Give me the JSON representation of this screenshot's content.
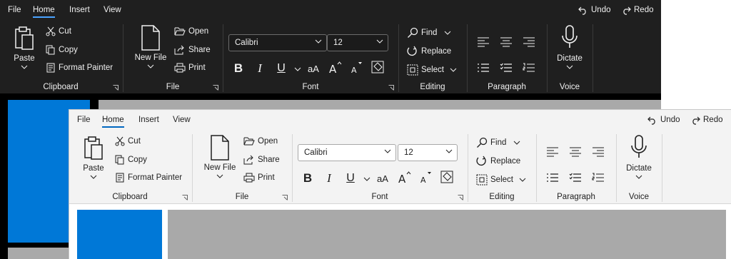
{
  "dark_window": {
    "menu": [
      "File",
      "Home",
      "Insert",
      "View"
    ],
    "active_menu": "Home",
    "undo": "Undo",
    "redo": "Redo",
    "clipboard": {
      "paste": "Paste",
      "cut": "Cut",
      "copy": "Copy",
      "format_painter": "Format Painter",
      "label": "Clipboard"
    },
    "file": {
      "new_file": "New File",
      "open": "Open",
      "share": "Share",
      "print": "Print",
      "label": "File"
    },
    "font": {
      "name": "Calibri",
      "size": "12",
      "label": "Font"
    },
    "editing": {
      "find": "Find",
      "replace": "Replace",
      "select": "Select",
      "label": "Editing"
    },
    "paragraph": {
      "label": "Paragraph"
    },
    "voice": {
      "dictate": "Dictate",
      "label": "Voice"
    }
  },
  "light_window": {
    "menu": [
      "File",
      "Home",
      "Insert",
      "View"
    ],
    "active_menu": "Home",
    "undo": "Undo",
    "redo": "Redo",
    "clipboard": {
      "paste": "Paste",
      "cut": "Cut",
      "copy": "Copy",
      "format_painter": "Format Painter",
      "label": "Clipboard"
    },
    "file": {
      "new_file": "New File",
      "open": "Open",
      "share": "Share",
      "print": "Print",
      "label": "File"
    },
    "font": {
      "name": "Calibri",
      "size": "12",
      "label": "Font"
    },
    "editing": {
      "find": "Find",
      "replace": "Replace",
      "select": "Select",
      "label": "Editing"
    },
    "paragraph": {
      "label": "Paragraph"
    },
    "voice": {
      "dictate": "Dictate",
      "label": "Voice"
    }
  },
  "colors": {
    "dark_bg": "#1f1f1f",
    "light_bg": "#f3f3f3",
    "accent_blue": "#0078d7",
    "canvas_gray": "#a9a9a9"
  }
}
